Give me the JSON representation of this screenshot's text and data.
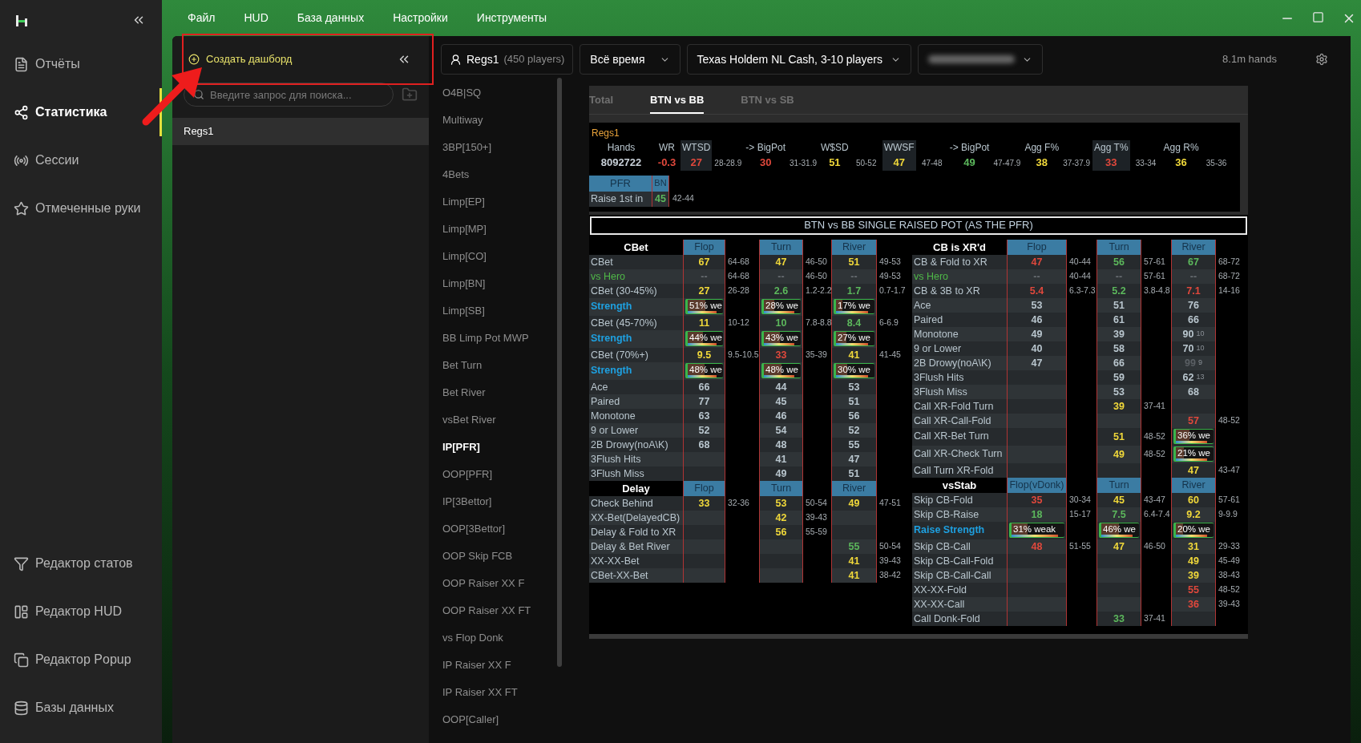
{
  "nav": {
    "items": [
      {
        "label": "Отчёты",
        "selected": false
      },
      {
        "label": "Статистика",
        "selected": true
      },
      {
        "label": "Сессии",
        "selected": false
      },
      {
        "label": "Отмеченные руки",
        "selected": false
      }
    ],
    "bottom_items": [
      {
        "label": "Редактор статов"
      },
      {
        "label": "Редактор HUD"
      },
      {
        "label": "Редактор Popup"
      },
      {
        "label": "Базы данных"
      }
    ]
  },
  "menu": [
    "Файл",
    "HUD",
    "База данных",
    "Настройки",
    "Инструменты"
  ],
  "dashboards": {
    "create_label": "Создать дашборд",
    "search_placeholder": "Введите запрос для поиска...",
    "items": [
      {
        "label": "Regs1",
        "selected": true
      }
    ]
  },
  "filters": {
    "player": "Regs1",
    "player_count": "(450 players)",
    "period": "Всё время",
    "game": "Texas Holdem NL Cash, 3-10 players",
    "hands": "8.1m hands"
  },
  "reports": [
    {
      "label": "O4B|SQ",
      "selected": false
    },
    {
      "label": "Multiway",
      "selected": false
    },
    {
      "label": "3BP[150+]",
      "selected": false
    },
    {
      "label": "4Bets",
      "selected": false
    },
    {
      "label": "Limp[EP]",
      "selected": false
    },
    {
      "label": "Limp[MP]",
      "selected": false
    },
    {
      "label": "Limp[CO]",
      "selected": false
    },
    {
      "label": "Limp[BN]",
      "selected": false
    },
    {
      "label": "Limp[SB]",
      "selected": false
    },
    {
      "label": "BB Limp Pot MWP",
      "selected": false
    },
    {
      "label": "Bet Turn",
      "selected": false
    },
    {
      "label": "Bet River",
      "selected": false
    },
    {
      "label": "vsBet River",
      "selected": false
    },
    {
      "label": "IP[PFR]",
      "selected": true
    },
    {
      "label": "OOP[PFR]",
      "selected": false
    },
    {
      "label": "IP[3Bettor]",
      "selected": false
    },
    {
      "label": "OOP[3Bettor]",
      "selected": false
    },
    {
      "label": "OOP Skip FCB",
      "selected": false
    },
    {
      "label": "OOP Raiser XX F",
      "selected": false
    },
    {
      "label": "OOP Raiser XX FT",
      "selected": false
    },
    {
      "label": "vs Flop Donk",
      "selected": false
    },
    {
      "label": "IP Raiser XX F",
      "selected": false
    },
    {
      "label": "IP Raiser XX FT",
      "selected": false
    },
    {
      "label": "OOP[Caller]",
      "selected": false
    }
  ],
  "tabs": [
    {
      "label": "Total",
      "selected": false
    },
    {
      "label": "BTN vs BB",
      "selected": true
    },
    {
      "label": "BTN vs SB",
      "selected": false
    }
  ],
  "summary": {
    "player": "Regs1",
    "stats": [
      {
        "label": "Hands",
        "value": "8092722",
        "color": "#c8d0d8",
        "highlighted": false
      },
      {
        "label": "WR",
        "value": "-0.3",
        "color": "#e0483c",
        "highlighted": false
      },
      {
        "label": "WTSD",
        "value": "27",
        "color": "#e0483c",
        "range": "28-28.9",
        "highlighted": true
      },
      {
        "label": "-> BigPot",
        "value": "30",
        "color": "#e0483c",
        "range": "31-31.9",
        "highlighted": false
      },
      {
        "label": "W$SD",
        "value": "51",
        "color": "#f0d83a",
        "range": "50-52",
        "highlighted": false
      },
      {
        "label": "WWSF",
        "value": "47",
        "color": "#f0d83a",
        "range": "47-48",
        "highlighted": true
      },
      {
        "label": "-> BigPot",
        "value": "49",
        "color": "#5cb85c",
        "range": "47-47.9",
        "highlighted": false
      },
      {
        "label": "Agg F%",
        "value": "38",
        "color": "#f0d83a",
        "range": "37-37.9",
        "highlighted": false
      },
      {
        "label": "Agg T%",
        "value": "33",
        "color": "#e0483c",
        "range": "33-34",
        "highlighted": true
      },
      {
        "label": "Agg R%",
        "value": "36",
        "color": "#f0d83a",
        "range": "35-36",
        "highlighted": false
      }
    ]
  },
  "pfr": {
    "header": "PFR",
    "position": "BN",
    "label": "Raise 1st in",
    "value": "45",
    "color": "#5cb85c",
    "range": "42-44"
  },
  "table": {
    "title": "BTN vs BB SINGLE RAISED POT (AS THE PFR)",
    "blocks": [
      {
        "sections": [
          {
            "title": "CBet",
            "columns": [
              "Flop",
              "Turn",
              "River"
            ],
            "rows": [
              {
                "label": "CBet",
                "kind": "stat",
                "cells": [
                  {
                    "kind": "stat",
                    "value": "67",
                    "color": "#f0d83a",
                    "range": "64-68"
                  },
                  {
                    "kind": "stat",
                    "value": "47",
                    "color": "#f0d83a",
                    "range": "46-50"
                  },
                  {
                    "kind": "stat",
                    "value": "51",
                    "color": "#f0d83a",
                    "range": "49-53"
                  }
                ]
              },
              {
                "label": "vs Hero",
                "kind": "hero",
                "cells": [
                  {
                    "kind": "stat",
                    "value": "--",
                    "color": "#6b7075",
                    "range": "64-68"
                  },
                  {
                    "kind": "stat",
                    "value": "--",
                    "color": "#6b7075",
                    "range": "46-50"
                  },
                  {
                    "kind": "stat",
                    "value": "--",
                    "color": "#6b7075",
                    "range": "49-53"
                  }
                ]
              },
              {
                "label": "CBet (30-45%)",
                "kind": "stat",
                "cells": [
                  {
                    "kind": "stat",
                    "value": "27",
                    "color": "#f0d83a",
                    "range": "26-28"
                  },
                  {
                    "kind": "stat",
                    "value": "2.6",
                    "color": "#5cb85c",
                    "range": "1.2-2.2"
                  },
                  {
                    "kind": "stat",
                    "value": "1.7",
                    "color": "#5cb85c",
                    "range": "0.7-1.7"
                  }
                ]
              },
              {
                "label": "Strength",
                "kind": "strength",
                "cells": [
                  {
                    "kind": "bar",
                    "text": "51% we",
                    "level": 0.51
                  },
                  {
                    "kind": "bar",
                    "text": "28% we",
                    "level": 0.28
                  },
                  {
                    "kind": "bar",
                    "text": "17% we",
                    "level": 0.17
                  }
                ]
              },
              {
                "label": "CBet (45-70%)",
                "kind": "stat",
                "cells": [
                  {
                    "kind": "stat",
                    "value": "11",
                    "color": "#f0d83a",
                    "range": "10-12"
                  },
                  {
                    "kind": "stat",
                    "value": "10",
                    "color": "#5cb85c",
                    "range": "7.8-8.8"
                  },
                  {
                    "kind": "stat",
                    "value": "8.4",
                    "color": "#5cb85c",
                    "range": "6-6.9"
                  }
                ]
              },
              {
                "label": "Strength",
                "kind": "strength",
                "cells": [
                  {
                    "kind": "bar",
                    "text": "44% we",
                    "level": 0.44
                  },
                  {
                    "kind": "bar",
                    "text": "43% we",
                    "level": 0.43
                  },
                  {
                    "kind": "bar",
                    "text": "27% we",
                    "level": 0.27
                  }
                ]
              },
              {
                "label": "CBet (70%+)",
                "kind": "stat",
                "cells": [
                  {
                    "kind": "stat",
                    "value": "9.5",
                    "color": "#f0d83a",
                    "range": "9.5-10.5"
                  },
                  {
                    "kind": "stat",
                    "value": "33",
                    "color": "#e0483c",
                    "range": "35-39"
                  },
                  {
                    "kind": "stat",
                    "value": "41",
                    "color": "#f0d83a",
                    "range": "41-45"
                  }
                ]
              },
              {
                "label": "Strength",
                "kind": "strength",
                "cells": [
                  {
                    "kind": "bar",
                    "text": "48% we",
                    "level": 0.48
                  },
                  {
                    "kind": "bar",
                    "text": "48% we",
                    "level": 0.48
                  },
                  {
                    "kind": "bar",
                    "text": "30% we",
                    "level": 0.3
                  }
                ]
              },
              {
                "label": "Ace",
                "kind": "stat",
                "cells": [
                  {
                    "kind": "stat",
                    "value": "66",
                    "color": "#b9c6ce"
                  },
                  {
                    "kind": "stat",
                    "value": "44",
                    "color": "#b9c6ce"
                  },
                  {
                    "kind": "stat",
                    "value": "53",
                    "color": "#b9c6ce"
                  }
                ]
              },
              {
                "label": "Paired",
                "kind": "stat",
                "cells": [
                  {
                    "kind": "stat",
                    "value": "77",
                    "color": "#b9c6ce"
                  },
                  {
                    "kind": "stat",
                    "value": "45",
                    "color": "#b9c6ce"
                  },
                  {
                    "kind": "stat",
                    "value": "51",
                    "color": "#b9c6ce"
                  }
                ]
              },
              {
                "label": "Monotone",
                "kind": "stat",
                "cells": [
                  {
                    "kind": "stat",
                    "value": "63",
                    "color": "#b9c6ce"
                  },
                  {
                    "kind": "stat",
                    "value": "46",
                    "color": "#b9c6ce"
                  },
                  {
                    "kind": "stat",
                    "value": "56",
                    "color": "#b9c6ce"
                  }
                ]
              },
              {
                "label": "9 or Lower",
                "kind": "stat",
                "cells": [
                  {
                    "kind": "stat",
                    "value": "52",
                    "color": "#b9c6ce"
                  },
                  {
                    "kind": "stat",
                    "value": "54",
                    "color": "#b9c6ce"
                  },
                  {
                    "kind": "stat",
                    "value": "52",
                    "color": "#b9c6ce"
                  }
                ]
              },
              {
                "label": "2B Drowy(noA\\K)",
                "kind": "stat",
                "cells": [
                  {
                    "kind": "stat",
                    "value": "68",
                    "color": "#b9c6ce"
                  },
                  {
                    "kind": "stat",
                    "value": "48",
                    "color": "#b9c6ce"
                  },
                  {
                    "kind": "stat",
                    "value": "55",
                    "color": "#b9c6ce"
                  }
                ]
              },
              {
                "label": "3Flush Hits",
                "kind": "stat",
                "cells": [
                  null,
                  {
                    "kind": "stat",
                    "value": "41",
                    "color": "#b9c6ce"
                  },
                  {
                    "kind": "stat",
                    "value": "47",
                    "color": "#b9c6ce"
                  }
                ]
              },
              {
                "label": "3Flush Miss",
                "kind": "stat",
                "cells": [
                  null,
                  {
                    "kind": "stat",
                    "value": "49",
                    "color": "#b9c6ce"
                  },
                  {
                    "kind": "stat",
                    "value": "51",
                    "color": "#b9c6ce"
                  }
                ]
              }
            ]
          },
          {
            "title": "Delay",
            "columns": [
              "Flop",
              "Turn",
              "River"
            ],
            "rows": [
              {
                "label": "Check Behind",
                "kind": "stat",
                "cells": [
                  {
                    "kind": "stat",
                    "value": "33",
                    "color": "#f0d83a",
                    "range": "32-36"
                  },
                  {
                    "kind": "stat",
                    "value": "53",
                    "color": "#f0d83a",
                    "range": "50-54"
                  },
                  {
                    "kind": "stat",
                    "value": "49",
                    "color": "#f0d83a",
                    "range": "47-51"
                  }
                ]
              },
              {
                "label": "XX-Bet(DelayedCB)",
                "kind": "stat",
                "cells": [
                  null,
                  {
                    "kind": "stat",
                    "value": "42",
                    "color": "#f0d83a",
                    "range": "39-43"
                  },
                  null
                ]
              },
              {
                "label": "Delay & Fold to XR",
                "kind": "stat",
                "cells": [
                  null,
                  {
                    "kind": "stat",
                    "value": "56",
                    "color": "#f0d83a",
                    "range": "55-59"
                  },
                  null
                ]
              },
              {
                "label": "Delay & Bet River",
                "kind": "stat",
                "cells": [
                  null,
                  null,
                  {
                    "kind": "stat",
                    "value": "55",
                    "color": "#5cb85c",
                    "range": "50-54"
                  }
                ]
              },
              {
                "label": "XX-XX-Bet",
                "kind": "stat",
                "cells": [
                  null,
                  null,
                  {
                    "kind": "stat",
                    "value": "41",
                    "color": "#f0d83a",
                    "range": "39-43"
                  }
                ]
              },
              {
                "label": "CBet-XX-Bet",
                "kind": "stat",
                "cells": [
                  null,
                  null,
                  {
                    "kind": "stat",
                    "value": "41",
                    "color": "#f0d83a",
                    "range": "38-42"
                  }
                ]
              }
            ]
          }
        ]
      },
      {
        "sections": [
          {
            "title": "CB is XR'd",
            "columns": [
              "Flop",
              "Turn",
              "River"
            ],
            "rows": [
              {
                "label": "CB & Fold to XR",
                "kind": "stat",
                "cells": [
                  {
                    "kind": "stat",
                    "value": "47",
                    "color": "#e0483c",
                    "range": "40-44"
                  },
                  {
                    "kind": "stat",
                    "value": "56",
                    "color": "#5cb85c",
                    "range": "57-61"
                  },
                  {
                    "kind": "stat",
                    "value": "67",
                    "color": "#5cb85c",
                    "range": "68-72"
                  }
                ]
              },
              {
                "label": "vs Hero",
                "kind": "hero",
                "cells": [
                  {
                    "kind": "stat",
                    "value": "--",
                    "color": "#6b7075",
                    "range": "40-44"
                  },
                  {
                    "kind": "stat",
                    "value": "--",
                    "color": "#6b7075",
                    "range": "57-61"
                  },
                  {
                    "kind": "stat",
                    "value": "--",
                    "color": "#6b7075",
                    "range": "68-72"
                  }
                ]
              },
              {
                "label": "CB & 3B to XR",
                "kind": "stat",
                "cells": [
                  {
                    "kind": "stat",
                    "value": "5.4",
                    "color": "#e0483c",
                    "range": "6.3-7.3"
                  },
                  {
                    "kind": "stat",
                    "value": "5.2",
                    "color": "#5cb85c",
                    "range": "3.8-4.8"
                  },
                  {
                    "kind": "stat",
                    "value": "7.1",
                    "color": "#e0483c",
                    "range": "14-16"
                  }
                ]
              },
              {
                "label": "Ace",
                "kind": "stat",
                "cells": [
                  {
                    "kind": "stat",
                    "value": "53",
                    "color": "#b9c6ce"
                  },
                  {
                    "kind": "stat",
                    "value": "51",
                    "color": "#b9c6ce"
                  },
                  {
                    "kind": "stat",
                    "value": "76",
                    "color": "#b9c6ce"
                  }
                ]
              },
              {
                "label": "Paired",
                "kind": "stat",
                "cells": [
                  {
                    "kind": "stat",
                    "value": "46",
                    "color": "#b9c6ce"
                  },
                  {
                    "kind": "stat",
                    "value": "61",
                    "color": "#b9c6ce"
                  },
                  {
                    "kind": "stat",
                    "value": "66",
                    "color": "#b9c6ce"
                  }
                ]
              },
              {
                "label": "Monotone",
                "kind": "stat",
                "cells": [
                  {
                    "kind": "stat",
                    "value": "49",
                    "color": "#b9c6ce"
                  },
                  {
                    "kind": "stat",
                    "value": "39",
                    "color": "#b9c6ce"
                  },
                  {
                    "kind": "stat",
                    "value": "90",
                    "color": "#b9c6ce",
                    "note": "10"
                  }
                ]
              },
              {
                "label": "9 or Lower",
                "kind": "stat",
                "cells": [
                  {
                    "kind": "stat",
                    "value": "40",
                    "color": "#b9c6ce"
                  },
                  {
                    "kind": "stat",
                    "value": "58",
                    "color": "#b9c6ce"
                  },
                  {
                    "kind": "stat",
                    "value": "70",
                    "color": "#b9c6ce",
                    "note": "10"
                  }
                ]
              },
              {
                "label": "2B Drowy(noA\\K)",
                "kind": "stat",
                "cells": [
                  {
                    "kind": "stat",
                    "value": "47",
                    "color": "#b9c6ce"
                  },
                  {
                    "kind": "stat",
                    "value": "66",
                    "color": "#b9c6ce"
                  },
                  {
                    "kind": "stat",
                    "value": "99",
                    "color": "#5a5f64",
                    "note": "9"
                  }
                ]
              },
              {
                "label": "3Flush Hits",
                "kind": "stat",
                "cells": [
                  null,
                  {
                    "kind": "stat",
                    "value": "59",
                    "color": "#b9c6ce"
                  },
                  {
                    "kind": "stat",
                    "value": "62",
                    "color": "#b9c6ce",
                    "note": "13"
                  }
                ]
              },
              {
                "label": "3Flush Miss",
                "kind": "stat",
                "cells": [
                  null,
                  {
                    "kind": "stat",
                    "value": "53",
                    "color": "#b9c6ce"
                  },
                  {
                    "kind": "stat",
                    "value": "68",
                    "color": "#b9c6ce"
                  }
                ]
              },
              {
                "label": "Call XR-Fold Turn",
                "kind": "stat",
                "cells": [
                  null,
                  {
                    "kind": "stat",
                    "value": "39",
                    "color": "#f0d83a",
                    "range": "37-41"
                  },
                  null
                ]
              },
              {
                "label": "Call XR-Call-Fold",
                "kind": "stat",
                "cells": [
                  null,
                  null,
                  {
                    "kind": "stat",
                    "value": "57",
                    "color": "#e0483c",
                    "range": "48-52"
                  }
                ]
              },
              {
                "label": "Call XR-Bet Turn",
                "kind": "stat",
                "cells": [
                  null,
                  {
                    "kind": "stat",
                    "value": "51",
                    "color": "#f0d83a",
                    "range": "48-52"
                  },
                  {
                    "kind": "bar",
                    "text": "36% we",
                    "level": 0.36
                  }
                ]
              },
              {
                "label": "Call XR-Check Turn",
                "kind": "stat",
                "cells": [
                  null,
                  {
                    "kind": "stat",
                    "value": "49",
                    "color": "#f0d83a",
                    "range": "48-52"
                  },
                  {
                    "kind": "bar",
                    "text": "21% we",
                    "level": 0.21
                  }
                ]
              },
              {
                "label": "Call Turn XR-Fold",
                "kind": "stat",
                "cells": [
                  null,
                  null,
                  {
                    "kind": "stat",
                    "value": "47",
                    "color": "#f0d83a",
                    "range": "43-47"
                  }
                ]
              }
            ]
          },
          {
            "title": "vsStab",
            "columns": [
              "Flop(vDonk)",
              "Turn",
              "River"
            ],
            "rows": [
              {
                "label": "Skip CB-Fold",
                "kind": "stat",
                "cells": [
                  {
                    "kind": "stat",
                    "value": "35",
                    "color": "#e0483c",
                    "range": "30-34"
                  },
                  {
                    "kind": "stat",
                    "value": "45",
                    "color": "#f0d83a",
                    "range": "43-47"
                  },
                  {
                    "kind": "stat",
                    "value": "60",
                    "color": "#f0d83a",
                    "range": "57-61"
                  }
                ]
              },
              {
                "label": "Skip CB-Raise",
                "kind": "stat",
                "cells": [
                  {
                    "kind": "stat",
                    "value": "18",
                    "color": "#5cb85c",
                    "range": "15-17"
                  },
                  {
                    "kind": "stat",
                    "value": "7.5",
                    "color": "#5cb85c",
                    "range": "6.4-7.4"
                  },
                  {
                    "kind": "stat",
                    "value": "9.2",
                    "color": "#f0d83a",
                    "range": "9-9.9"
                  }
                ]
              },
              {
                "label": "Raise Strength",
                "kind": "strength",
                "cells": [
                  {
                    "kind": "bar",
                    "text": "31% weak",
                    "level": 0.31
                  },
                  {
                    "kind": "bar",
                    "text": "46% we",
                    "level": 0.46
                  },
                  {
                    "kind": "bar",
                    "text": "20% we",
                    "level": 0.2
                  }
                ]
              },
              {
                "label": "Skip CB-Call",
                "kind": "stat",
                "cells": [
                  {
                    "kind": "stat",
                    "value": "48",
                    "color": "#e0483c",
                    "range": "51-55"
                  },
                  {
                    "kind": "stat",
                    "value": "47",
                    "color": "#f0d83a",
                    "range": "46-50"
                  },
                  {
                    "kind": "stat",
                    "value": "31",
                    "color": "#f0d83a",
                    "range": "29-33"
                  }
                ]
              },
              {
                "label": "Skip CB-Call-Fold",
                "kind": "stat",
                "cells": [
                  null,
                  null,
                  {
                    "kind": "stat",
                    "value": "49",
                    "color": "#f0d83a",
                    "range": "45-49"
                  }
                ]
              },
              {
                "label": "Skip CB-Call-Call",
                "kind": "stat",
                "cells": [
                  null,
                  null,
                  {
                    "kind": "stat",
                    "value": "39",
                    "color": "#f0d83a",
                    "range": "38-43"
                  }
                ]
              },
              {
                "label": "XX-XX-Fold",
                "kind": "stat",
                "cells": [
                  null,
                  null,
                  {
                    "kind": "stat",
                    "value": "55",
                    "color": "#e0483c",
                    "range": "48-52"
                  }
                ]
              },
              {
                "label": "XX-XX-Call",
                "kind": "stat",
                "cells": [
                  null,
                  null,
                  {
                    "kind": "stat",
                    "value": "36",
                    "color": "#e0483c",
                    "range": "39-43"
                  }
                ]
              },
              {
                "label": "Call Donk-Fold",
                "kind": "stat",
                "cells": [
                  null,
                  {
                    "kind": "stat",
                    "value": "33",
                    "color": "#5cb85c",
                    "range": "37-41"
                  },
                  null
                ]
              }
            ]
          }
        ]
      }
    ]
  }
}
